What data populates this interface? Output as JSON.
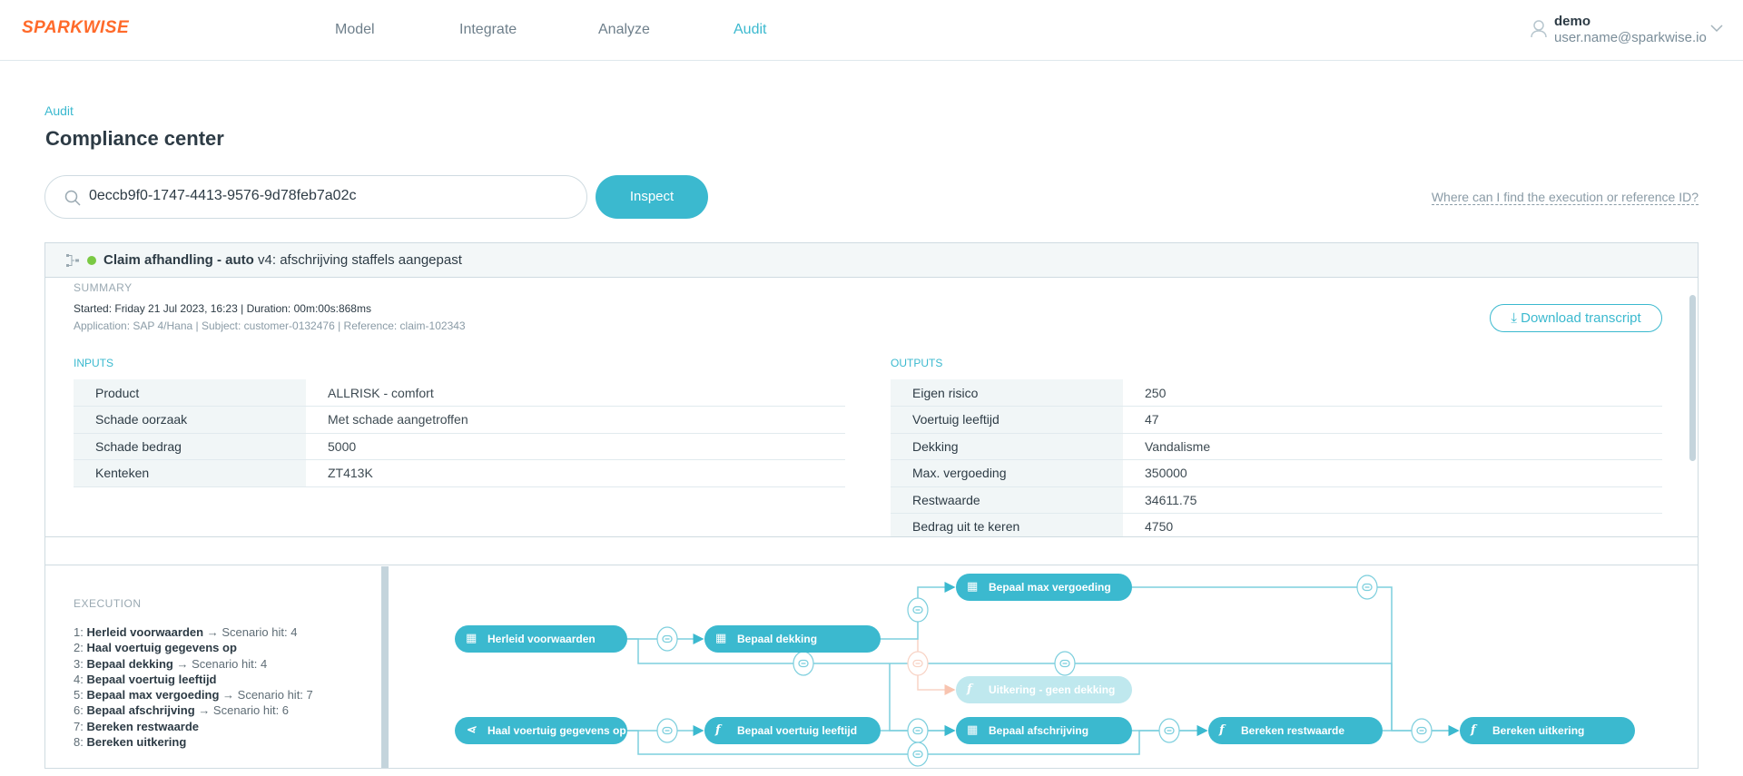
{
  "brand": {
    "logo": "SPARKWISE",
    "accent": "#3bb9cf",
    "logo_color": "#ff6a2a"
  },
  "nav": {
    "items": [
      {
        "label": "Model"
      },
      {
        "label": "Integrate"
      },
      {
        "label": "Analyze"
      },
      {
        "label": "Audit",
        "active": true
      }
    ]
  },
  "user": {
    "name": "demo",
    "email": "user.name@sparkwise.io",
    "icon": "user-icon"
  },
  "breadcrumb": "Audit",
  "title": "Compliance center",
  "search": {
    "value": "0eccb9f0-1747-4413-9576-9d78feb7a02c",
    "button": "Inspect",
    "help": "Where can I find the execution or reference ID?"
  },
  "execution": {
    "model_name": "Claim afhandling - auto",
    "version": "v4: afschrijving staffels aangepast",
    "status_color": "#7ac943",
    "summary_label": "SUMMARY",
    "started_label": "Started: ",
    "started": "Friday 21 Jul 2023, 16:23",
    "duration_label": " | Duration: ",
    "duration": "00m:00s:868ms",
    "meta": "Application: SAP 4/Hana | Subject: customer-0132476 | Reference: claim-102343",
    "download": "Download transcript",
    "inputs_label": "INPUTS",
    "inputs": [
      {
        "k": "Product",
        "v": "ALLRISK - comfort"
      },
      {
        "k": "Schade oorzaak",
        "v": "Met schade aangetroffen"
      },
      {
        "k": "Schade bedrag",
        "v": "5000"
      },
      {
        "k": "Kenteken",
        "v": "ZT413K"
      }
    ],
    "outputs_label": "OUTPUTS",
    "outputs": [
      {
        "k": "Eigen risico",
        "v": "250"
      },
      {
        "k": "Voertuig leeftijd",
        "v": "47"
      },
      {
        "k": "Dekking",
        "v": "Vandalisme"
      },
      {
        "k": "Max. vergoeding",
        "v": "350000"
      },
      {
        "k": "Restwaarde",
        "v": "34611.75"
      },
      {
        "k": "Bedrag uit te keren",
        "v": "4750"
      }
    ],
    "exec_label": "EXECUTION",
    "steps": [
      {
        "n": "1:",
        "name": "Herleid voorwaarden",
        "hit": "→ Scenario hit: 4"
      },
      {
        "n": "2:",
        "name": "Haal voertuig gegevens op",
        "hit": ""
      },
      {
        "n": "3:",
        "name": "Bepaal dekking",
        "hit": "→ Scenario hit: 4"
      },
      {
        "n": "4:",
        "name": "Bepaal voertuig leeftijd",
        "hit": ""
      },
      {
        "n": "5:",
        "name": "Bepaal max vergoeding",
        "hit": "→ Scenario hit: 7"
      },
      {
        "n": "6:",
        "name": "Bepaal afschrijving",
        "hit": "→ Scenario hit: 6"
      },
      {
        "n": "7:",
        "name": "Bereken restwaarde",
        "hit": ""
      },
      {
        "n": "8:",
        "name": "Bereken uitkering",
        "hit": ""
      }
    ]
  },
  "flow": {
    "nodes": [
      {
        "label": "Herleid voorwaarden",
        "icon": "table-icon"
      },
      {
        "label": "Bepaal dekking",
        "icon": "table-icon"
      },
      {
        "label": "Bepaal max vergoeding",
        "icon": "table-icon"
      },
      {
        "label": "Uitkering - geen dekking",
        "icon": "function-icon",
        "state": "not-executed"
      },
      {
        "label": "Haal voertuig gegevens op",
        "icon": "share-icon"
      },
      {
        "label": "Bepaal voertuig leeftijd",
        "icon": "function-icon"
      },
      {
        "label": "Bepaal afschrijving",
        "icon": "table-icon"
      },
      {
        "label": "Bereken restwaarde",
        "icon": "function-icon"
      },
      {
        "label": "Bereken uitkering",
        "icon": "function-icon"
      }
    ]
  }
}
